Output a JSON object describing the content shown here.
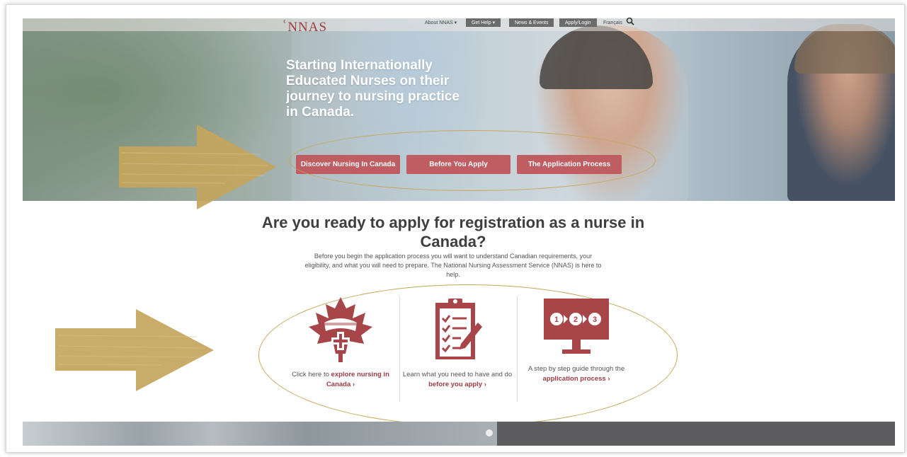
{
  "header": {
    "logo_text": "NNAS",
    "nav": {
      "about": "About NNAS ▾",
      "get_help": "Get Help ▾",
      "news": "News & Events",
      "apply": "Apply/Login",
      "language": "Français"
    }
  },
  "hero": {
    "headline": "Starting Internationally Educated Nurses on their journey to nursing practice in Canada.",
    "buttons": [
      "Discover Nursing In Canada",
      "Before You Apply",
      "The Application Process"
    ]
  },
  "main": {
    "question": "Are you ready to apply for registration as a nurse in Canada?",
    "intro": "Before you begin the application process you will want to understand Canadian requirements, your eligibility, and what you will need to prepare. The National Nursing Assessment Service (NNAS) is here to help.",
    "columns": [
      {
        "icon": "maple-leaf-nurse-cap-icon",
        "text_before": "Click here to ",
        "link": "explore nursing in Canada ›",
        "text_after": ""
      },
      {
        "icon": "clipboard-checklist-icon",
        "text_before": "Learn what you need to have and do ",
        "link": "before you apply ›",
        "text_after": ""
      },
      {
        "icon": "monitor-steps-icon",
        "text_before": "A step by step guide through the ",
        "link": "application process ›",
        "text_after": ""
      }
    ],
    "step_numbers": [
      "1",
      "2",
      "3"
    ]
  },
  "colors": {
    "brand": "#9e3b40",
    "button": "#bf5d62",
    "annotation_gold": "#c6a75a"
  }
}
